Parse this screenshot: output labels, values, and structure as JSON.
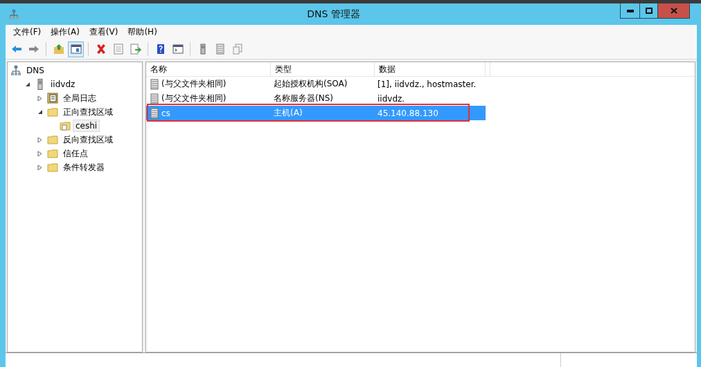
{
  "window": {
    "title": "DNS 管理器"
  },
  "menu": [
    {
      "label": "文件(F)"
    },
    {
      "label": "操作(A)"
    },
    {
      "label": "查看(V)"
    },
    {
      "label": "帮助(H)"
    }
  ],
  "toolbar": [
    [
      {
        "kind": "back",
        "pressed": false
      },
      {
        "kind": "forward",
        "pressed": false
      }
    ],
    [
      {
        "kind": "up",
        "pressed": false
      },
      {
        "kind": "tree",
        "pressed": true
      }
    ],
    [
      {
        "kind": "delete",
        "pressed": false
      },
      {
        "kind": "properties",
        "pressed": false
      },
      {
        "kind": "export",
        "pressed": false
      }
    ],
    [
      {
        "kind": "help",
        "pressed": false
      },
      {
        "kind": "panel",
        "pressed": false
      }
    ],
    [
      {
        "kind": "server",
        "pressed": false
      },
      {
        "kind": "list",
        "pressed": false
      },
      {
        "kind": "copy",
        "pressed": false
      }
    ]
  ],
  "tree": [
    {
      "label": "DNS",
      "kind": "root",
      "selected": false,
      "children": [
        {
          "label": "iidvdz",
          "kind": "server",
          "selected": false,
          "expanded": true,
          "children": [
            {
              "label": "全局日志",
              "kind": "log",
              "selected": false,
              "expanded": false
            },
            {
              "label": "正向查找区域",
              "kind": "folder",
              "selected": false,
              "expanded": true,
              "children": [
                {
                  "label": "ceshi",
                  "kind": "zone",
                  "selected": true
                }
              ]
            },
            {
              "label": "反向查找区域",
              "kind": "folder",
              "selected": false,
              "expanded": false
            },
            {
              "label": "信任点",
              "kind": "folder",
              "selected": false,
              "expanded": false
            },
            {
              "label": "条件转发器",
              "kind": "folder",
              "selected": false,
              "expanded": false
            }
          ]
        }
      ]
    }
  ],
  "table": {
    "columns": [
      "名称",
      "类型",
      "数据"
    ],
    "rows": [
      {
        "cells": [
          "(与父文件夹相同)",
          "起始授权机构(SOA)",
          "[1], iidvdz., hostmaster."
        ],
        "selected": false,
        "outlined": false
      },
      {
        "cells": [
          "(与父文件夹相同)",
          "名称服务器(NS)",
          "iidvdz."
        ],
        "selected": false,
        "outlined": false
      },
      {
        "cells": [
          "cs",
          "主机(A)",
          "45.140.88.130"
        ],
        "selected": true,
        "outlined": true
      }
    ]
  }
}
